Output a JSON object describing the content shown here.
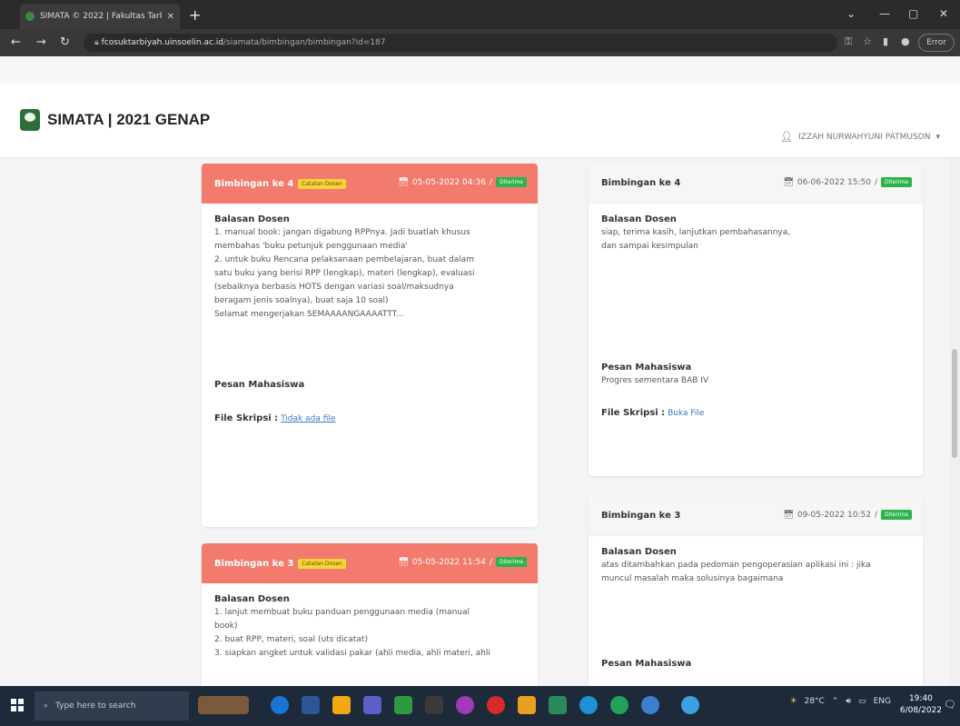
{
  "browser": {
    "tab_title": "SIMATA © 2022 | Fakultas Tarbiy",
    "url_host": "fcosuktarbiyah.uinsoelin.ac.id",
    "url_path": "/siamata/bimbingan/bimbingan?id=187",
    "error_label": "Error"
  },
  "app": {
    "brand": "SIMATA | 2021 GENAP",
    "user": "IZZAH NURWAHYUNI PATMUSON"
  },
  "left_cards": [
    {
      "title": "Bimbingan ke 4",
      "badge": "Catatan Dosen",
      "date": "05-05-2022 04:36",
      "status": "Diterima",
      "reply_label": "Balasan Dosen",
      "reply_lines": [
        "1. manual book: jangan digabung RPPnya. Jadi buatlah khusus",
        "membahas 'buku petunjuk penggunaan media'",
        "2. untuk buku Rencana pelaksanaan pembelajaran, buat dalam",
        "satu buku yang berisi RPP (lengkap), materi (lengkap), evaluasi",
        "(sebaiknya berbasis HOTS dengan variasi soal/maksudnya",
        "beragam jenis soalnya), buat saja 10 soal)",
        "Selamat mengerjakan SEMAAAANGAAAATTT..."
      ],
      "message_label": "Pesan Mahasiswa",
      "message": "",
      "file_label": "File Skripsi :",
      "file_value": "Tidak ada file"
    },
    {
      "title": "Bimbingan ke 3",
      "badge": "Catatan Dosen",
      "date": "05-05-2022 11:54",
      "status": "Diterima",
      "reply_label": "Balasan Dosen",
      "reply_lines": [
        "1. lanjut membuat buku panduan penggunaan media (manual",
        "book)",
        "2. buat RPP, materi, soal (uts dicatat)",
        "3. siapkan angket untuk validasi pakar (ahli media, ahli materi, ahli"
      ]
    }
  ],
  "right_cards": [
    {
      "title": "Bimbingan ke 4",
      "date": "06-06-2022 15:50",
      "status": "Diterima",
      "reply_label": "Balasan Dosen",
      "reply_lines": [
        "siap, terima kasih, lanjutkan pembahasannya,",
        "dan sampai kesimpulan"
      ],
      "message_label": "Pesan Mahasiswa",
      "message": "Progres sementara BAB IV",
      "file_label": "File Skripsi :",
      "file_value": "Buka File"
    },
    {
      "title": "Bimbingan ke 3",
      "date": "09-05-2022 10:52",
      "status": "Diterima",
      "reply_label": "Balasan Dosen",
      "reply_lines": [
        "atas ditambahkan pada pedoman pengoperasian aplikasi ini : jika",
        "muncul masalah maka solusinya bagaimana"
      ],
      "message_label": "Pesan Mahasiswa"
    }
  ],
  "taskbar": {
    "search_placeholder": "Type here to search",
    "weather": "28°C",
    "time": "19:40",
    "date": "6/08/2022",
    "lang": "ENG"
  },
  "colors": {
    "card_header_red": "#f27b6e",
    "badge_green": "#2bb44a",
    "badge_yellow": "#f7d43a",
    "link": "#3a78c9"
  }
}
